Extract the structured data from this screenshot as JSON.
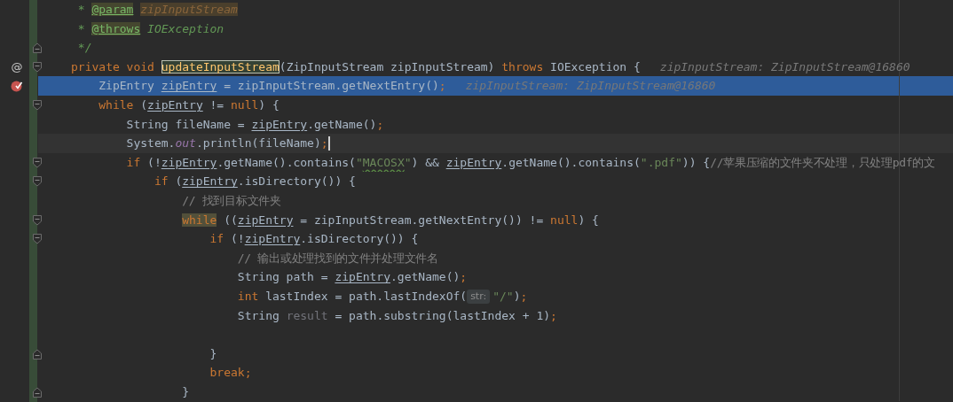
{
  "lines": [
    {
      "execution": false,
      "caret": false,
      "tokens": [
        {
          "kind": "d",
          "text": " * "
        },
        {
          "kind": "dt",
          "text": "@param"
        },
        {
          "kind": "dp",
          "text": "zipInputStream"
        }
      ]
    },
    {
      "execution": false,
      "caret": false,
      "tokens": [
        {
          "kind": "d",
          "text": " * "
        },
        {
          "kind": "dt",
          "text": "@throws"
        },
        {
          "kind": "d",
          "text": " IOException"
        }
      ]
    },
    {
      "execution": false,
      "caret": false,
      "fold": {
        "kind": "end"
      },
      "tokens": [
        {
          "kind": "d",
          "text": " */"
        }
      ]
    },
    {
      "execution": false,
      "caret": false,
      "fold": {
        "kind": "start"
      },
      "gutter_icon": {
        "kind": "override",
        "glyph": "@"
      },
      "tokens": [
        {
          "kind": "k",
          "text": "private void "
        },
        {
          "kind": "decl",
          "text": "updateInputStream"
        },
        {
          "kind": "p",
          "text": "(ZipInputStream zipInputStream) "
        },
        {
          "kind": "k",
          "text": "throws "
        },
        {
          "kind": "p",
          "text": "IOException {"
        },
        {
          "kind": "hint",
          "text": "zipInputStream: ZipInputStream@16860"
        }
      ]
    },
    {
      "execution": true,
      "caret": false,
      "gutter_icon": {
        "kind": "breakpoint"
      },
      "tokens": [
        {
          "kind": "p",
          "text": "    ZipEntry "
        },
        {
          "kind": "v",
          "text": "zipEntry"
        },
        {
          "kind": "p",
          "text": " = zipInputStream.getNextEntry()"
        },
        {
          "kind": "k",
          "text": ";"
        },
        {
          "kind": "hint",
          "text": "zipInputStream: ZipInputStream@16860"
        }
      ]
    },
    {
      "execution": false,
      "caret": false,
      "fold": {
        "kind": "start"
      },
      "tokens": [
        {
          "kind": "k",
          "text": "    while "
        },
        {
          "kind": "p",
          "text": "("
        },
        {
          "kind": "v",
          "text": "zipEntry"
        },
        {
          "kind": "p",
          "text": " != "
        },
        {
          "kind": "k",
          "text": "null"
        },
        {
          "kind": "p",
          "text": ") {"
        }
      ]
    },
    {
      "execution": false,
      "caret": false,
      "tokens": [
        {
          "kind": "p",
          "text": "        String fileName = "
        },
        {
          "kind": "v",
          "text": "zipEntry"
        },
        {
          "kind": "p",
          "text": ".getName()"
        },
        {
          "kind": "k",
          "text": ";"
        }
      ]
    },
    {
      "execution": false,
      "caret": true,
      "tokens": [
        {
          "kind": "p",
          "text": "        System."
        },
        {
          "kind": "f",
          "text": "out"
        },
        {
          "kind": "p",
          "text": ".println(fileName)"
        },
        {
          "kind": "k",
          "text": ";"
        }
      ]
    },
    {
      "execution": false,
      "caret": false,
      "fold": {
        "kind": "start"
      },
      "tokens": [
        {
          "kind": "k",
          "text": "        if "
        },
        {
          "kind": "p",
          "text": "(!"
        },
        {
          "kind": "v",
          "text": "zipEntry"
        },
        {
          "kind": "p",
          "text": ".getName().contains("
        },
        {
          "kind": "s",
          "text": "\""
        },
        {
          "kind": "sq",
          "text": "MACOSX"
        },
        {
          "kind": "s",
          "text": "\""
        },
        {
          "kind": "p",
          "text": ") && "
        },
        {
          "kind": "v",
          "text": "zipEntry"
        },
        {
          "kind": "p",
          "text": ".getName().contains("
        },
        {
          "kind": "s",
          "text": "\".pdf\""
        },
        {
          "kind": "p",
          "text": ")) {"
        },
        {
          "kind": "c",
          "text": "//苹果压缩的文件夹不处理，只处理pdf的文"
        }
      ]
    },
    {
      "execution": false,
      "caret": false,
      "fold": {
        "kind": "start"
      },
      "tokens": [
        {
          "kind": "k",
          "text": "            if "
        },
        {
          "kind": "p",
          "text": "("
        },
        {
          "kind": "v",
          "text": "zipEntry"
        },
        {
          "kind": "p",
          "text": ".isDirectory()) {"
        }
      ]
    },
    {
      "execution": false,
      "caret": false,
      "tokens": [
        {
          "kind": "c",
          "text": "                // 找到目标文件夹"
        }
      ]
    },
    {
      "execution": false,
      "caret": false,
      "fold": {
        "kind": "start"
      },
      "tokens": [
        {
          "kind": "kh",
          "text": "                while"
        },
        {
          "kind": "p",
          "text": " (("
        },
        {
          "kind": "v",
          "text": "zipEntry"
        },
        {
          "kind": "p",
          "text": " = zipInputStream.getNextEntry()) != "
        },
        {
          "kind": "k",
          "text": "null"
        },
        {
          "kind": "p",
          "text": ") {"
        }
      ]
    },
    {
      "execution": false,
      "caret": false,
      "fold": {
        "kind": "start"
      },
      "tokens": [
        {
          "kind": "k",
          "text": "                    if "
        },
        {
          "kind": "p",
          "text": "(!"
        },
        {
          "kind": "v",
          "text": "zipEntry"
        },
        {
          "kind": "p",
          "text": ".isDirectory()) {"
        }
      ]
    },
    {
      "execution": false,
      "caret": false,
      "tokens": [
        {
          "kind": "c",
          "text": "                        // 输出或处理找到的文件并处理文件名"
        }
      ]
    },
    {
      "execution": false,
      "caret": false,
      "tokens": [
        {
          "kind": "p",
          "text": "                        String path = "
        },
        {
          "kind": "v",
          "text": "zipEntry"
        },
        {
          "kind": "p",
          "text": ".getName()"
        },
        {
          "kind": "k",
          "text": ";"
        }
      ]
    },
    {
      "execution": false,
      "caret": false,
      "tokens": [
        {
          "kind": "k",
          "text": "                        int "
        },
        {
          "kind": "p",
          "text": "lastIndex = path.lastIndexOf("
        },
        {
          "kind": "inlay",
          "text": "str:"
        },
        {
          "kind": "s",
          "text": "\"/\""
        },
        {
          "kind": "p",
          "text": ")"
        },
        {
          "kind": "k",
          "text": ";"
        }
      ]
    },
    {
      "execution": false,
      "caret": false,
      "tokens": [
        {
          "kind": "p",
          "text": "                        String "
        },
        {
          "kind": "u",
          "text": "result"
        },
        {
          "kind": "p",
          "text": " = path.substring(lastIndex + 1)"
        },
        {
          "kind": "k",
          "text": ";"
        }
      ]
    },
    {
      "execution": false,
      "caret": false
    },
    {
      "execution": false,
      "caret": false,
      "fold": {
        "kind": "end"
      },
      "tokens": [
        {
          "kind": "p",
          "text": "                    }"
        }
      ]
    },
    {
      "execution": false,
      "caret": false,
      "tokens": [
        {
          "kind": "k",
          "text": "                    break;"
        }
      ]
    },
    {
      "execution": false,
      "caret": false,
      "fold": {
        "kind": "end"
      },
      "tokens": [
        {
          "kind": "p",
          "text": "                }"
        }
      ]
    }
  ]
}
